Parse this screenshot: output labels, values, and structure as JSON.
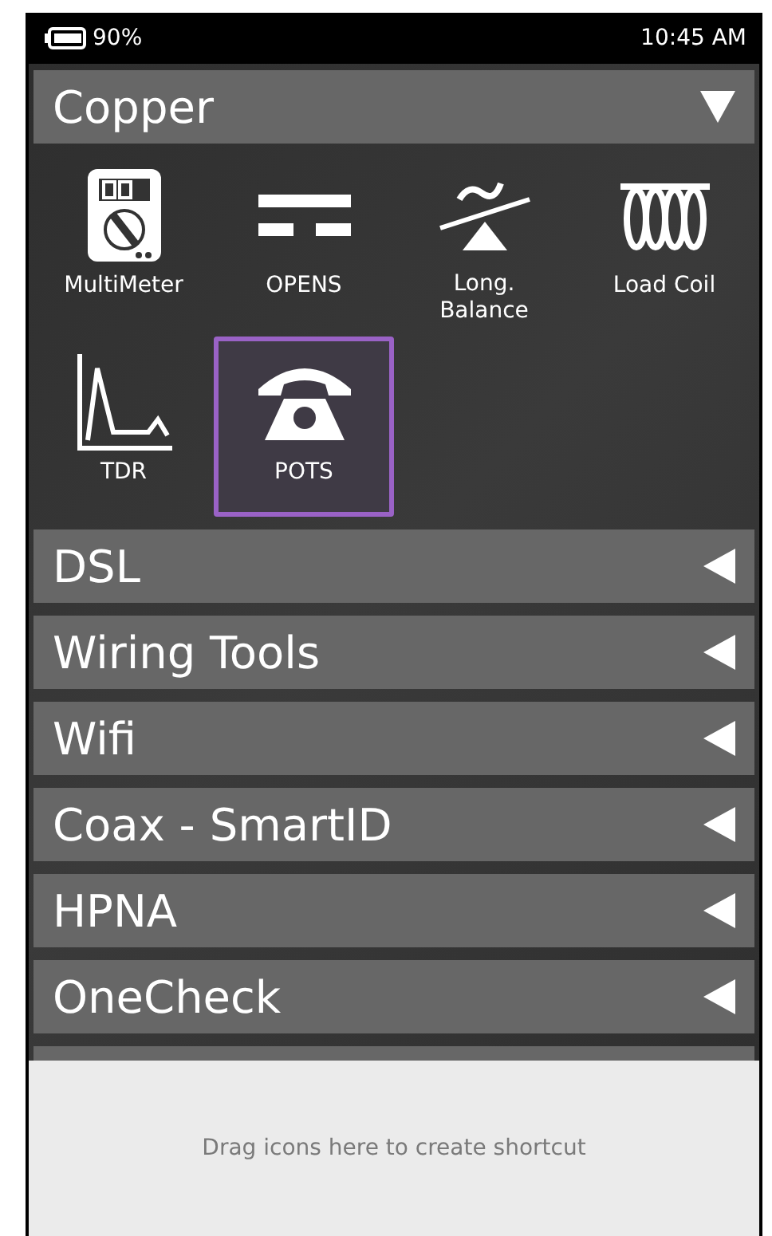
{
  "status_bar": {
    "battery": "90%",
    "time": "10:45 AM"
  },
  "sections": [
    {
      "title": "Copper",
      "expanded": true,
      "tiles": [
        {
          "label": "MultiMeter",
          "kind": "multimeter",
          "selected": false
        },
        {
          "label": "OPENS",
          "kind": "opens",
          "selected": false
        },
        {
          "label": "Long.\nBalance",
          "kind": "balance",
          "selected": false
        },
        {
          "label": "Load Coil",
          "kind": "coil",
          "selected": false
        },
        {
          "label": "TDR",
          "kind": "tdr",
          "selected": false
        },
        {
          "label": "POTS",
          "kind": "phone",
          "selected": true
        }
      ]
    },
    {
      "title": "DSL",
      "expanded": false
    },
    {
      "title": "Wiring Tools",
      "expanded": false
    },
    {
      "title": "Wifi",
      "expanded": false
    },
    {
      "title": "Coax - SmartID",
      "expanded": false
    },
    {
      "title": "HPNA",
      "expanded": false
    },
    {
      "title": "OneCheck",
      "expanded": false
    }
  ],
  "shortcut_area": {
    "hint": "Drag icons here to create shortcut"
  }
}
